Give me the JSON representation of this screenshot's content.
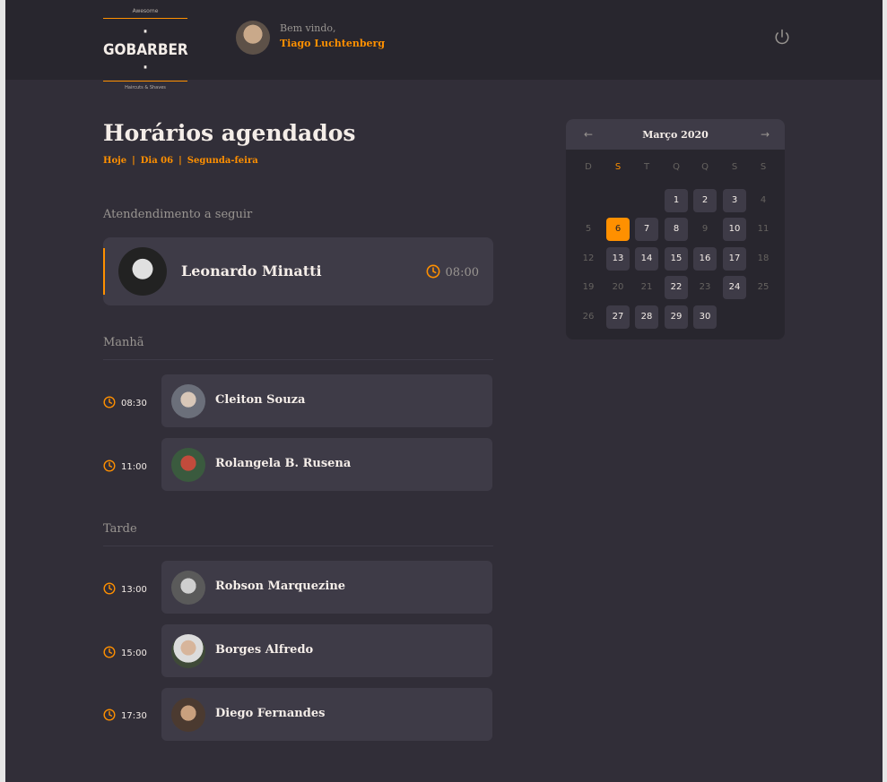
{
  "header": {
    "logo_top": "Awesome",
    "logo_brand": "· GOBARBER ·",
    "logo_bottom": "Haircuts & Shaves",
    "welcome": "Bem vindo,",
    "user_name": "Tiago Luchtenberg",
    "logout_icon": "power-icon"
  },
  "page": {
    "title": "Horários agendados",
    "subtitle_today": "Hoje",
    "subtitle_day": "Dia 06",
    "subtitle_weekday": "Segunda-feira",
    "separator": "|"
  },
  "next": {
    "label": "Atendendimento a seguir",
    "name": "Leonardo Minatti",
    "time": "08:00"
  },
  "morning": {
    "label": "Manhã",
    "items": [
      {
        "time": "08:30",
        "name": "Cleiton Souza"
      },
      {
        "time": "11:00",
        "name": "Rolangela B. Rusena"
      }
    ]
  },
  "afternoon": {
    "label": "Tarde",
    "items": [
      {
        "time": "13:00",
        "name": "Robson Marquezine"
      },
      {
        "time": "15:00",
        "name": "Borges Alfredo"
      },
      {
        "time": "17:30",
        "name": "Diego Fernandes"
      }
    ]
  },
  "calendar": {
    "month": "Março 2020",
    "prev_icon": "arrow-left-icon",
    "next_icon": "arrow-right-icon",
    "weekdays": [
      "D",
      "S",
      "T",
      "Q",
      "Q",
      "S",
      "S"
    ],
    "days": [
      {
        "d": "1",
        "s": "av"
      },
      {
        "d": "2",
        "s": "av"
      },
      {
        "d": "3",
        "s": "av"
      },
      {
        "d": "4",
        "s": "off"
      },
      {
        "d": "5",
        "s": "off"
      },
      {
        "d": "6",
        "s": "sel"
      },
      {
        "d": "7",
        "s": "av"
      },
      {
        "d": "8",
        "s": "av"
      },
      {
        "d": "9",
        "s": "off"
      },
      {
        "d": "10",
        "s": "av"
      },
      {
        "d": "11",
        "s": "off"
      },
      {
        "d": "12",
        "s": "off"
      },
      {
        "d": "13",
        "s": "av"
      },
      {
        "d": "14",
        "s": "av"
      },
      {
        "d": "15",
        "s": "av"
      },
      {
        "d": "16",
        "s": "av"
      },
      {
        "d": "17",
        "s": "av"
      },
      {
        "d": "18",
        "s": "off"
      },
      {
        "d": "19",
        "s": "off"
      },
      {
        "d": "20",
        "s": "off"
      },
      {
        "d": "21",
        "s": "off"
      },
      {
        "d": "22",
        "s": "av"
      },
      {
        "d": "23",
        "s": "off"
      },
      {
        "d": "24",
        "s": "av"
      },
      {
        "d": "25",
        "s": "off"
      },
      {
        "d": "26",
        "s": "off"
      },
      {
        "d": "27",
        "s": "av"
      },
      {
        "d": "28",
        "s": "av"
      },
      {
        "d": "29",
        "s": "av"
      },
      {
        "d": "30",
        "s": "av"
      }
    ]
  },
  "colors": {
    "accent": "#ff9000",
    "background": "#312e38",
    "header_bg": "#28262e",
    "card_bg": "#3e3b47",
    "muted": "#999591"
  }
}
